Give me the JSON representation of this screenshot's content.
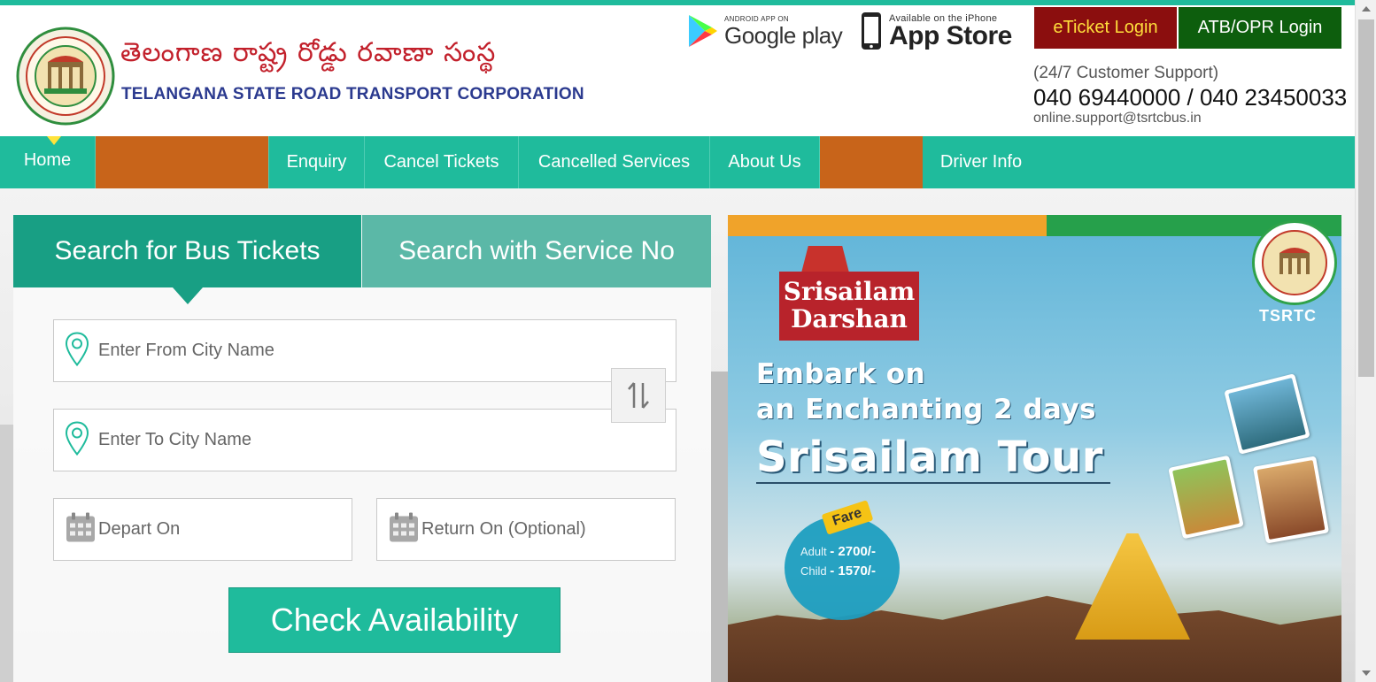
{
  "header": {
    "telugu_title": "తెలంగాణ  రాష్ట్ర రోడ్డు రవాణా సంస్థ",
    "english_title": "TELANGANA STATE ROAD TRANSPORT CORPORATION",
    "google_play": {
      "small": "ANDROID APP ON",
      "big": "Google play"
    },
    "app_store": {
      "small": "Available on the iPhone",
      "big": "App Store"
    },
    "eticket_login": "eTicket Login",
    "atb_login": "ATB/OPR Login",
    "support_label": "(24/7 Customer Support)",
    "support_phone": "040 69440000 / 040 23450033",
    "support_email": "online.support@tsrtcbus.in"
  },
  "nav": {
    "home": "Home",
    "enquiry": "Enquiry",
    "cancel_tickets": "Cancel Tickets",
    "cancelled_services": "Cancelled Services",
    "about_us": "About Us",
    "driver_info": "Driver Info"
  },
  "search": {
    "tab_bus": "Search for Bus Tickets",
    "tab_service": "Search with Service No",
    "from_placeholder": "Enter From City Name",
    "to_placeholder": "Enter To City Name",
    "depart_placeholder": "Depart On",
    "return_placeholder": "Return On (Optional)",
    "check_button": "Check Availability"
  },
  "banner": {
    "title": "Srisailam Darshan",
    "line1": "Embark on",
    "line2": "an Enchanting 2 days",
    "line3": "Srisailam Tour",
    "brand": "TSRTC",
    "fare_tag": "Fare",
    "fare_adult_label": "Adult",
    "fare_adult_value": "- 2700/-",
    "fare_child_label": "Child",
    "fare_child_value": "- 1570/-"
  },
  "colors": {
    "primary_teal": "#1fbb9c",
    "tab_active": "#189f84",
    "tab_inactive": "#5bb8a7",
    "nav_orange": "#c8641a",
    "eticket_bg": "#8b0e0e",
    "eticket_text": "#ffde3b",
    "atb_bg": "#0d5e0d"
  },
  "icons": {
    "location": "location-pin-icon",
    "calendar": "calendar-icon",
    "swap": "swap-arrows-icon"
  }
}
